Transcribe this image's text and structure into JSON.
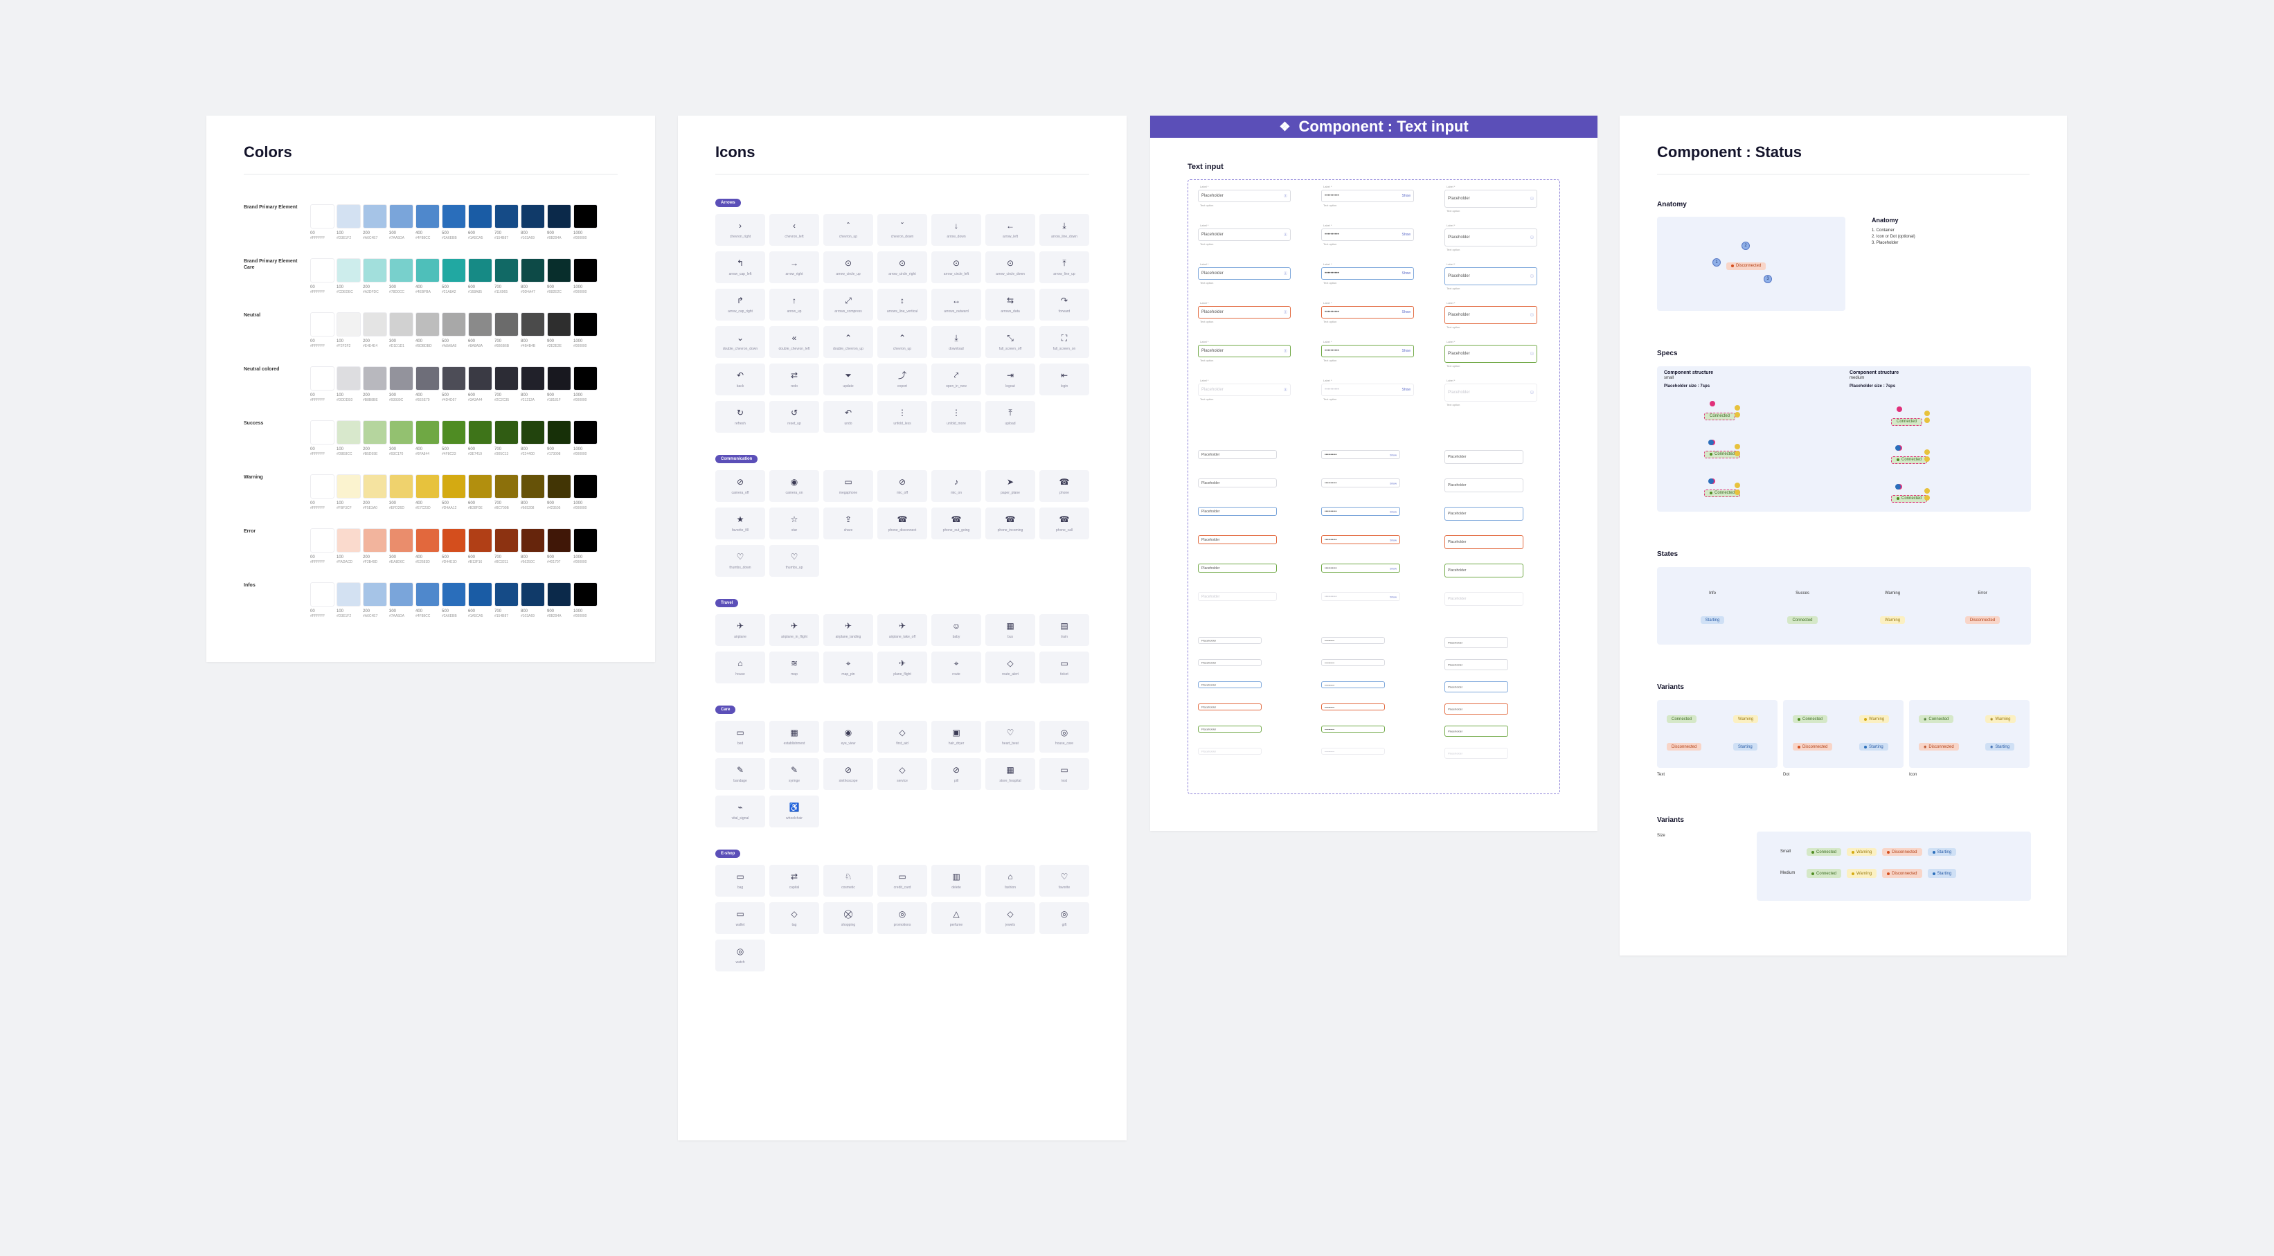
{
  "colors_board": {
    "title": "Colors",
    "rows": [
      {
        "name": "Brand Primary Element",
        "swatches": [
          "#FFFFFF",
          "#D3E1F2",
          "#A6C4E7",
          "#7AA5DA",
          "#4F88CC",
          "#2A6EBB",
          "#1A5CA5",
          "#154B87",
          "#103A69",
          "#0B294A",
          "#000000"
        ]
      },
      {
        "name": "Brand Primary Element Care",
        "swatches": [
          "#FFFFFF",
          "#CDEDEC",
          "#A2DFDC",
          "#78D0CC",
          "#4EBFBA",
          "#21A8A2",
          "#168A85",
          "#116965",
          "#0D4A47",
          "#082E2C",
          "#000000"
        ]
      },
      {
        "name": "Neutral",
        "swatches": [
          "#FFFFFF",
          "#F2F2F2",
          "#E4E4E4",
          "#D1D1D1",
          "#BDBDBD",
          "#A8A8A8",
          "#8A8A8A",
          "#6B6B6B",
          "#4B4B4B",
          "#2E2E2E",
          "#000000"
        ]
      },
      {
        "name": "Neutral colored",
        "swatches": [
          "#FFFFFF",
          "#DDDDE0",
          "#B8B8BE",
          "#93939C",
          "#6E6E79",
          "#4D4D57",
          "#3A3A44",
          "#2C2C35",
          "#21212A",
          "#18181F",
          "#000000"
        ]
      },
      {
        "name": "Success",
        "swatches": [
          "#FFFFFF",
          "#D8E8CC",
          "#B5D59E",
          "#93C170",
          "#6FA844",
          "#4F8C23",
          "#3E7419",
          "#305C13",
          "#22440D",
          "#173008",
          "#000000"
        ]
      },
      {
        "name": "Warning",
        "swatches": [
          "#FFFFFF",
          "#FBF3CF",
          "#F5E3A0",
          "#EFD26D",
          "#E7C23D",
          "#D4AA12",
          "#B28F0E",
          "#8C700B",
          "#665208",
          "#423505",
          "#000000"
        ]
      },
      {
        "name": "Error",
        "swatches": [
          "#FFFFFF",
          "#FADACD",
          "#F2B49D",
          "#EA8D6C",
          "#E2683D",
          "#D44E1D",
          "#B13F16",
          "#8C3211",
          "#66250C",
          "#401707",
          "#000000"
        ]
      },
      {
        "name": "Infos",
        "swatches": [
          "#FFFFFF",
          "#D3E1F2",
          "#A6C4E7",
          "#7AA5DA",
          "#4F88CC",
          "#2A6EBB",
          "#1A5CA5",
          "#154B87",
          "#103A69",
          "#0B294A",
          "#000000"
        ]
      }
    ],
    "steps": [
      "00",
      "100",
      "200",
      "300",
      "400",
      "500",
      "600",
      "700",
      "800",
      "900",
      "1000"
    ],
    "hexes": [
      [
        "#FFFFFF",
        "#D3E1F2",
        "#A6C4E7",
        "#7AA5DA",
        "#4F88CC",
        "#2A6EBB",
        "#1A5CA5",
        "#154B87",
        "#103A69",
        "#0B294A",
        "#000000"
      ],
      [
        "#FFFFFF",
        "#CDEDEC",
        "#A2DFDC",
        "#78D0CC",
        "#4EBFBA",
        "#21A8A2",
        "#168A85",
        "#116965",
        "#0D4A47",
        "#082E2C",
        "#000000"
      ],
      [
        "#FFFFFF",
        "#F2F2F2",
        "#E4E4E4",
        "#D1D1D1",
        "#BDBDBD",
        "#A8A8A8",
        "#8A8A8A",
        "#6B6B6B",
        "#4B4B4B",
        "#2E2E2E",
        "#000000"
      ],
      [
        "#FFFFFF",
        "#DDDDE0",
        "#B8B8BE",
        "#93939C",
        "#6E6E79",
        "#4D4D57",
        "#3A3A44",
        "#2C2C35",
        "#21212A",
        "#18181F",
        "#000000"
      ],
      [
        "#FFFFFF",
        "#D8E8CC",
        "#B5D59E",
        "#93C170",
        "#6FA844",
        "#4F8C23",
        "#3E7419",
        "#305C13",
        "#22440D",
        "#173008",
        "#000000"
      ],
      [
        "#FFFFFF",
        "#FBF3CF",
        "#F5E3A0",
        "#EFD26D",
        "#E7C23D",
        "#D4AA12",
        "#B28F0E",
        "#8C700B",
        "#665208",
        "#423505",
        "#000000"
      ],
      [
        "#FFFFFF",
        "#FADACD",
        "#F2B49D",
        "#EA8D6C",
        "#E2683D",
        "#D44E1D",
        "#B13F16",
        "#8C3211",
        "#66250C",
        "#401707",
        "#000000"
      ],
      [
        "#FFFFFF",
        "#D3E1F2",
        "#A6C4E7",
        "#7AA5DA",
        "#4F88CC",
        "#2A6EBB",
        "#1A5CA5",
        "#154B87",
        "#103A69",
        "#0B294A",
        "#000000"
      ]
    ]
  },
  "icons_board": {
    "title": "Icons",
    "groups": [
      {
        "tag": "Arrows",
        "icons": [
          {
            "g": "›",
            "n": "chevron_right"
          },
          {
            "g": "‹",
            "n": "chevron_left"
          },
          {
            "g": "ˆ",
            "n": "chevron_up"
          },
          {
            "g": "ˇ",
            "n": "chevron_down"
          },
          {
            "g": "↓",
            "n": "arrow_down"
          },
          {
            "g": "←",
            "n": "arrow_left"
          },
          {
            "g": "⤓",
            "n": "arrow_line_down"
          },
          {
            "g": "↰",
            "n": "arrow_cap_left"
          },
          {
            "g": "→",
            "n": "arrow_right"
          },
          {
            "g": "⊙",
            "n": "arrow_circle_up"
          },
          {
            "g": "⊙",
            "n": "arrow_circle_right"
          },
          {
            "g": "⊙",
            "n": "arrow_circle_left"
          },
          {
            "g": "⊙",
            "n": "arrow_circle_down"
          },
          {
            "g": "⤒",
            "n": "arrow_line_up"
          },
          {
            "g": "↱",
            "n": "arrow_cap_right"
          },
          {
            "g": "↑",
            "n": "arrow_up"
          },
          {
            "g": "⤢",
            "n": "arrows_compress"
          },
          {
            "g": "↕",
            "n": "arrows_line_vertical"
          },
          {
            "g": "↔",
            "n": "arrows_outward"
          },
          {
            "g": "⇆",
            "n": "arrows_data"
          },
          {
            "g": "↷",
            "n": "forward"
          },
          {
            "g": "⌄",
            "n": "double_chevron_down"
          },
          {
            "g": "«",
            "n": "double_chevron_left"
          },
          {
            "g": "⌃",
            "n": "double_chevron_up"
          },
          {
            "g": "⌃",
            "n": "chevron_up"
          },
          {
            "g": "⤓",
            "n": "download"
          },
          {
            "g": "⤡",
            "n": "full_screen_off"
          },
          {
            "g": "⛶",
            "n": "full_screen_on"
          },
          {
            "g": "↶",
            "n": "back"
          },
          {
            "g": "⇄",
            "n": "redo"
          },
          {
            "g": "⏷",
            "n": "update"
          },
          {
            "g": "⤴",
            "n": "export"
          },
          {
            "g": "⤤",
            "n": "open_in_new"
          },
          {
            "g": "⇥",
            "n": "logout"
          },
          {
            "g": "⇤",
            "n": "login"
          },
          {
            "g": "↻",
            "n": "refresh"
          },
          {
            "g": "↺",
            "n": "reset_up"
          },
          {
            "g": "↶",
            "n": "undo"
          },
          {
            "g": "⋮",
            "n": "unfold_less"
          },
          {
            "g": "⋮",
            "n": "unfold_more"
          },
          {
            "g": "⤒",
            "n": "upload"
          }
        ]
      },
      {
        "tag": "Communication",
        "icons": [
          {
            "g": "⊘",
            "n": "camera_off"
          },
          {
            "g": "◉",
            "n": "camera_on"
          },
          {
            "g": "▭",
            "n": "megaphone"
          },
          {
            "g": "⊘",
            "n": "mic_off"
          },
          {
            "g": "♪",
            "n": "mic_on"
          },
          {
            "g": "➤",
            "n": "paper_plane"
          },
          {
            "g": "☎",
            "n": "phone"
          },
          {
            "g": "★",
            "n": "favorite_fill"
          },
          {
            "g": "☆",
            "n": "star"
          },
          {
            "g": "⇪",
            "n": "share"
          },
          {
            "g": "☎",
            "n": "phone_disconnect"
          },
          {
            "g": "☎",
            "n": "phone_out_going"
          },
          {
            "g": "☎",
            "n": "phone_incoming"
          },
          {
            "g": "☎",
            "n": "phone_call"
          },
          {
            "g": "♡",
            "n": "thumbs_down"
          },
          {
            "g": "♡",
            "n": "thumbs_up"
          }
        ]
      },
      {
        "tag": "Travel",
        "icons": [
          {
            "g": "✈",
            "n": "airplane"
          },
          {
            "g": "✈",
            "n": "airplane_in_flight"
          },
          {
            "g": "✈",
            "n": "airplane_landing"
          },
          {
            "g": "✈",
            "n": "airplane_take_off"
          },
          {
            "g": "☺",
            "n": "baby"
          },
          {
            "g": "▦",
            "n": "bus"
          },
          {
            "g": "▤",
            "n": "train"
          },
          {
            "g": "⌂",
            "n": "house"
          },
          {
            "g": "≋",
            "n": "map"
          },
          {
            "g": "⌖",
            "n": "map_pin"
          },
          {
            "g": "✈",
            "n": "plane_flight"
          },
          {
            "g": "⌖",
            "n": "route"
          },
          {
            "g": "◇",
            "n": "route_alert"
          },
          {
            "g": "▭",
            "n": "ticket"
          }
        ]
      },
      {
        "tag": "Care",
        "icons": [
          {
            "g": "▭",
            "n": "bed"
          },
          {
            "g": "▦",
            "n": "establishment"
          },
          {
            "g": "◉",
            "n": "eye_view"
          },
          {
            "g": "◇",
            "n": "first_aid"
          },
          {
            "g": "▣",
            "n": "hair_dryer"
          },
          {
            "g": "♡",
            "n": "heart_beat"
          },
          {
            "g": "◎",
            "n": "house_care"
          },
          {
            "g": "✎",
            "n": "bandage"
          },
          {
            "g": "✎",
            "n": "syringe"
          },
          {
            "g": "⊘",
            "n": "stethoscope"
          },
          {
            "g": "◇",
            "n": "service"
          },
          {
            "g": "⊘",
            "n": "pill"
          },
          {
            "g": "▦",
            "n": "store_hospital"
          },
          {
            "g": "▭",
            "n": "test"
          },
          {
            "g": "⌁",
            "n": "vital_signal"
          },
          {
            "g": "♿",
            "n": "wheelchair"
          }
        ]
      },
      {
        "tag": "E-shop",
        "icons": [
          {
            "g": "▭",
            "n": "bag"
          },
          {
            "g": "⇄",
            "n": "capital"
          },
          {
            "g": "♘",
            "n": "cosmetic"
          },
          {
            "g": "▭",
            "n": "credit_card"
          },
          {
            "g": "▥",
            "n": "delete"
          },
          {
            "g": "⌂",
            "n": "fashion"
          },
          {
            "g": "♡",
            "n": "favorite"
          },
          {
            "g": "▭",
            "n": "wallet"
          },
          {
            "g": "◇",
            "n": "tag"
          },
          {
            "g": "⛒",
            "n": "shopping"
          },
          {
            "g": "◎",
            "n": "promotions"
          },
          {
            "g": "△",
            "n": "perfume"
          },
          {
            "g": "◇",
            "n": "jewels"
          },
          {
            "g": "◎",
            "n": "gift"
          },
          {
            "g": "◎",
            "n": "watch"
          }
        ]
      }
    ]
  },
  "text_input_board": {
    "header": "Component : Text input",
    "section": "Text input",
    "placeholder": "Placeholder",
    "label": "Label *",
    "helper": "Text option",
    "show": "Show",
    "password": "••••••••••"
  },
  "status_board": {
    "title": "Component : Status",
    "anatomy_section": "Anatomy",
    "anatomy_title": "Anatomy",
    "anatomy_items": [
      "1. Container",
      "2. Icon or Dot (optional)",
      "3. Placeholder"
    ],
    "anatomy_badge": "Disconnected",
    "specs_section": "Specs",
    "specs": [
      {
        "title": "Component structure",
        "sub": "small",
        "size": "Placeholder size : 7sps"
      },
      {
        "title": "Component structure",
        "sub": "medium",
        "size": "Placeholder size : 7sps"
      }
    ],
    "states_section": "States",
    "states": [
      {
        "label": "Info",
        "badge": "Starting",
        "kind": "info"
      },
      {
        "label": "Succes",
        "badge": "Connected",
        "kind": "success"
      },
      {
        "label": "Warning",
        "badge": "Warning",
        "kind": "warning"
      },
      {
        "label": "Error",
        "badge": "Disconnected",
        "kind": "error"
      }
    ],
    "variants_section": "Variants",
    "variant_groups": [
      {
        "caption": "Text"
      },
      {
        "caption": "Dot"
      },
      {
        "caption": "Icon"
      }
    ],
    "badges": {
      "connected": "Connected",
      "warning": "Warning",
      "disconnected": "Disconnected",
      "starting": "Starting"
    },
    "variants2_section": "Variants",
    "size_label": "Size",
    "sizes": [
      "Small",
      "Medium"
    ]
  }
}
